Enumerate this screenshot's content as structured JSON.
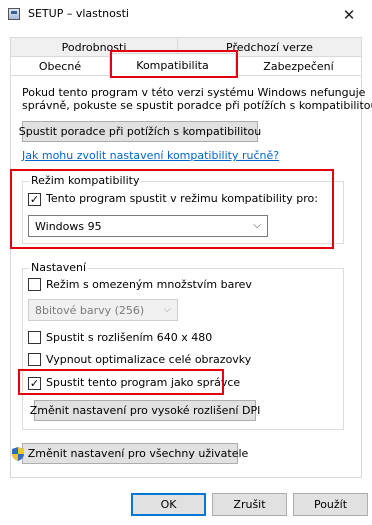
{
  "window": {
    "title": "SETUP – vlastnosti",
    "close_glyph": "✕"
  },
  "tabs": {
    "back_row": [
      "Podrobnosti",
      "Předchozí verze"
    ],
    "front_row": [
      "Obecné",
      "Kompatibilita",
      "Zabezpečení"
    ],
    "active": "Kompatibilita"
  },
  "intro": {
    "line1": "Pokud tento program v této verzi systému Windows nefunguje",
    "line2": "správně, pokuste se spustit poradce při potížích s kompatibilitou."
  },
  "troubleshooter_button": "Spustit poradce při potížích s kompatibilitou",
  "manual_link": "Jak mohu zvolit nastavení kompatibility ručně?",
  "compat_mode": {
    "group_label": "Režim kompatibility",
    "checkbox_label": "Tento program spustit v režimu kompatibility pro:",
    "checked": true,
    "selected_os": "Windows 95"
  },
  "settings": {
    "group_label": "Nastavení",
    "reduced_color": {
      "label": "Režim s omezeným množstvím barev",
      "checked": false
    },
    "color_select": "8bitové barvy (256)",
    "resolution_640": {
      "label": "Spustit s rozlišením 640 x 480",
      "checked": false
    },
    "disable_fullscreen_opt": {
      "label": "Vypnout optimalizace celé obrazovky",
      "checked": false
    },
    "run_as_admin": {
      "label": "Spustit tento program jako správce",
      "checked": true
    },
    "high_dpi_button": "Změnit nastavení pro vysoké rozlišení DPI"
  },
  "all_users_button": "Změnit nastavení pro všechny uživatele",
  "footer": {
    "ok": "OK",
    "cancel": "Zrušit",
    "apply": "Použít"
  },
  "colors": {
    "highlight_red": "#e3000f",
    "link_blue": "#0066cc",
    "focus_blue": "#0078d7"
  }
}
